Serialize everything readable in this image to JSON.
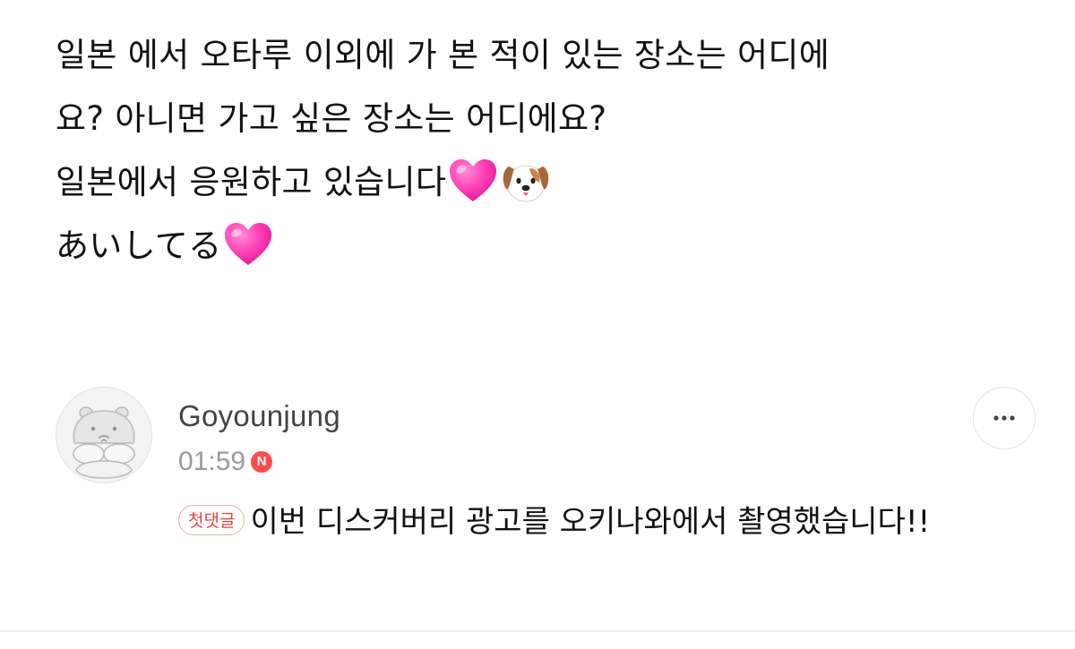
{
  "post": {
    "lines": [
      "일본 에서 오타루 이외에 가 본 적이 있는 장소는 어디에",
      "요? 아니면 가고 싶은 장소는 어디에요?",
      "일본에서 응원하고 있습니다",
      "あいしてる"
    ]
  },
  "comment": {
    "author": "Goyounjung",
    "time": "01:59",
    "new_badge": "N",
    "first_comment_badge": "첫댓글",
    "text": "이번 디스커버리 광고를 오키나와에서 촬영했습니다!!",
    "more_label": "···"
  },
  "icons": {
    "heart": "pink-heart-icon",
    "dog": "dog-face-icon",
    "more": "more-options-icon",
    "avatar": "hippo-avatar-icon"
  },
  "colors": {
    "heart": "#ff3fb4",
    "new_badge": "#ff4b4b",
    "first_badge": "#e8423f"
  }
}
